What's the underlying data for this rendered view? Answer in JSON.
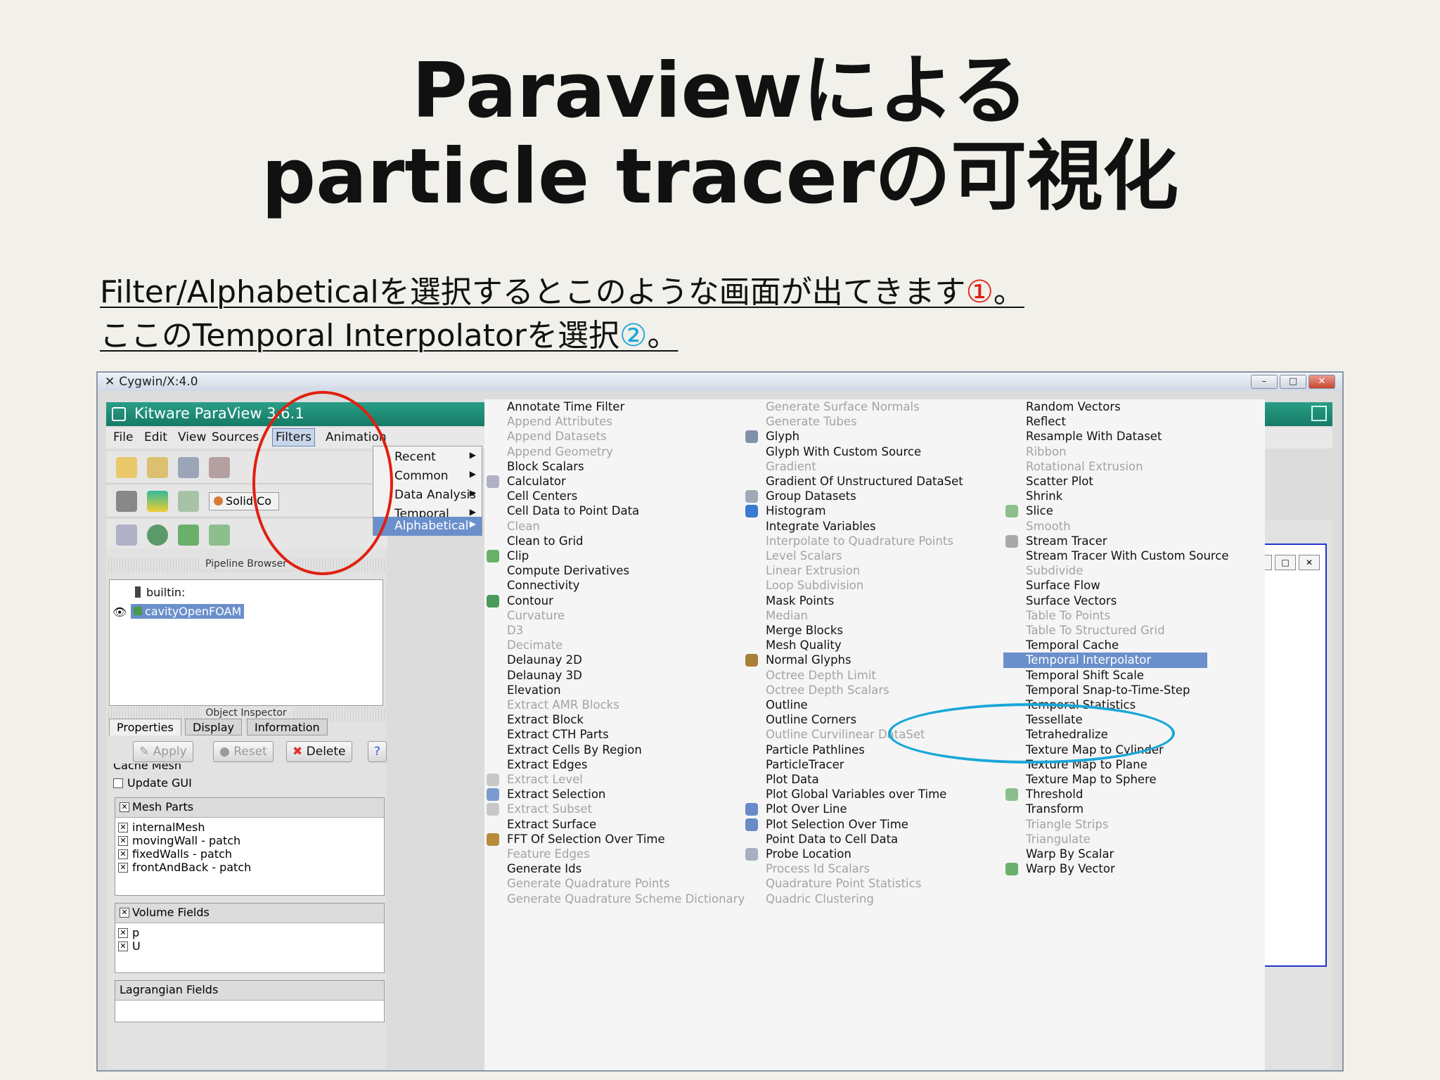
{
  "slide": {
    "title_line1": "Paraviewによる",
    "title_line2": "particle tracerの可視化",
    "desc_line1_text": "Filter/Alphabeticalを選択するとこのような画面が出てきます",
    "desc_line1_mark": "①",
    "desc_line1_end": "。",
    "desc_line2_text": "ここのTemporal Interpolatorを選択",
    "desc_line2_mark": "②",
    "desc_line2_end": "。"
  },
  "window": {
    "title": "Cygwin/X:4.0",
    "controls": [
      "–",
      "□",
      "✕"
    ],
    "app_title": "Kitware ParaView 3.6.1"
  },
  "menubar": {
    "items": [
      "File",
      "Edit",
      "View",
      "Sources",
      "Filters",
      "Animation"
    ],
    "active": "Filters"
  },
  "filters_menu": {
    "items": [
      "Recent",
      "Common",
      "Data Analysis",
      "Temporal",
      "Alphabetical"
    ],
    "selected": "Alphabetical"
  },
  "toolbar": {
    "representation_label": "Solid Co"
  },
  "pipeline": {
    "header": "Pipeline Browser",
    "root": "builtin:",
    "source": "cavityOpenFOAM"
  },
  "inspector": {
    "header": "Object Inspector",
    "tabs": [
      "Properties",
      "Display",
      "Information"
    ],
    "buttons": {
      "apply": "Apply",
      "reset": "Reset",
      "delete": "Delete",
      "help": "?"
    },
    "cache_mesh": "Cache Mesh",
    "update_gui": "Update GUI",
    "mesh_parts_title": "Mesh Parts",
    "mesh_parts": [
      "internalMesh",
      "movingWall - patch",
      "fixedWalls - patch",
      "frontAndBack - patch"
    ],
    "volume_fields_title": "Volume Fields",
    "volume_fields": [
      "p",
      "U"
    ],
    "lagrangian_title": "Lagrangian Fields"
  },
  "alphabetical": {
    "col1": [
      {
        "label": "Annotate Time Filter",
        "enabled": true
      },
      {
        "label": "Append Attributes",
        "enabled": false
      },
      {
        "label": "Append Datasets",
        "enabled": false
      },
      {
        "label": "Append Geometry",
        "enabled": false
      },
      {
        "label": "Block Scalars",
        "enabled": true
      },
      {
        "label": "Calculator",
        "enabled": true,
        "icon": "calculator-icon"
      },
      {
        "label": "Cell Centers",
        "enabled": true
      },
      {
        "label": "Cell Data to Point Data",
        "enabled": true
      },
      {
        "label": "Clean",
        "enabled": false
      },
      {
        "label": "Clean to Grid",
        "enabled": true
      },
      {
        "label": "Clip",
        "enabled": true,
        "icon": "clip-icon"
      },
      {
        "label": "Compute Derivatives",
        "enabled": true
      },
      {
        "label": "Connectivity",
        "enabled": true
      },
      {
        "label": "Contour",
        "enabled": true,
        "icon": "contour-icon"
      },
      {
        "label": "Curvature",
        "enabled": false
      },
      {
        "label": "D3",
        "enabled": false
      },
      {
        "label": "Decimate",
        "enabled": false
      },
      {
        "label": "Delaunay 2D",
        "enabled": true
      },
      {
        "label": "Delaunay 3D",
        "enabled": true
      },
      {
        "label": "Elevation",
        "enabled": true
      },
      {
        "label": "Extract AMR Blocks",
        "enabled": false
      },
      {
        "label": "Extract Block",
        "enabled": true
      },
      {
        "label": "Extract CTH Parts",
        "enabled": true
      },
      {
        "label": "Extract Cells By Region",
        "enabled": true
      },
      {
        "label": "Extract Edges",
        "enabled": true
      },
      {
        "label": "Extract Level",
        "enabled": false,
        "icon": "extract-level-icon"
      },
      {
        "label": "Extract Selection",
        "enabled": true,
        "icon": "extract-selection-icon"
      },
      {
        "label": "Extract Subset",
        "enabled": false,
        "icon": "extract-subset-icon"
      },
      {
        "label": "Extract Surface",
        "enabled": true
      },
      {
        "label": "FFT Of Selection Over Time",
        "enabled": true,
        "icon": "fft-icon"
      },
      {
        "label": "Feature Edges",
        "enabled": false
      },
      {
        "label": "Generate Ids",
        "enabled": true
      },
      {
        "label": "Generate Quadrature Points",
        "enabled": false
      },
      {
        "label": "Generate Quadrature Scheme Dictionary",
        "enabled": false
      }
    ],
    "col2": [
      {
        "label": "Generate Surface Normals",
        "enabled": false
      },
      {
        "label": "Generate Tubes",
        "enabled": false
      },
      {
        "label": "Glyph",
        "enabled": true,
        "icon": "glyph-icon"
      },
      {
        "label": "Glyph With Custom Source",
        "enabled": true
      },
      {
        "label": "Gradient",
        "enabled": false
      },
      {
        "label": "Gradient Of Unstructured DataSet",
        "enabled": true
      },
      {
        "label": "Group Datasets",
        "enabled": true,
        "icon": "group-icon"
      },
      {
        "label": "Histogram",
        "enabled": true,
        "icon": "histogram-icon"
      },
      {
        "label": "Integrate Variables",
        "enabled": true
      },
      {
        "label": "Interpolate to Quadrature Points",
        "enabled": false
      },
      {
        "label": "Level Scalars",
        "enabled": false
      },
      {
        "label": "Linear Extrusion",
        "enabled": false
      },
      {
        "label": "Loop Subdivision",
        "enabled": false
      },
      {
        "label": "Mask Points",
        "enabled": true
      },
      {
        "label": "Median",
        "enabled": false
      },
      {
        "label": "Merge Blocks",
        "enabled": true
      },
      {
        "label": "Mesh Quality",
        "enabled": true
      },
      {
        "label": "Normal Glyphs",
        "enabled": true,
        "icon": "normal-glyphs-icon"
      },
      {
        "label": "Octree Depth Limit",
        "enabled": false
      },
      {
        "label": "Octree Depth Scalars",
        "enabled": false
      },
      {
        "label": "Outline",
        "enabled": true
      },
      {
        "label": "Outline Corners",
        "enabled": true
      },
      {
        "label": "Outline Curvilinear DataSet",
        "enabled": false
      },
      {
        "label": "Particle Pathlines",
        "enabled": true
      },
      {
        "label": "ParticleTracer",
        "enabled": true
      },
      {
        "label": "Plot Data",
        "enabled": true
      },
      {
        "label": "Plot Global Variables over Time",
        "enabled": true
      },
      {
        "label": "Plot Over Line",
        "enabled": true,
        "icon": "plot-over-line-icon"
      },
      {
        "label": "Plot Selection Over Time",
        "enabled": true,
        "icon": "plot-selection-icon"
      },
      {
        "label": "Point Data to Cell Data",
        "enabled": true
      },
      {
        "label": "Probe Location",
        "enabled": true,
        "icon": "probe-icon"
      },
      {
        "label": "Process Id Scalars",
        "enabled": false
      },
      {
        "label": "Quadrature Point Statistics",
        "enabled": false
      },
      {
        "label": "Quadric Clustering",
        "enabled": false
      }
    ],
    "col3": [
      {
        "label": "Random Vectors",
        "enabled": true
      },
      {
        "label": "Reflect",
        "enabled": true
      },
      {
        "label": "Resample With Dataset",
        "enabled": true
      },
      {
        "label": "Ribbon",
        "enabled": false
      },
      {
        "label": "Rotational Extrusion",
        "enabled": false
      },
      {
        "label": "Scatter Plot",
        "enabled": true
      },
      {
        "label": "Shrink",
        "enabled": true
      },
      {
        "label": "Slice",
        "enabled": true,
        "icon": "slice-icon"
      },
      {
        "label": "Smooth",
        "enabled": false
      },
      {
        "label": "Stream Tracer",
        "enabled": true,
        "icon": "stream-tracer-icon"
      },
      {
        "label": "Stream Tracer With Custom Source",
        "enabled": true
      },
      {
        "label": "Subdivide",
        "enabled": false
      },
      {
        "label": "Surface Flow",
        "enabled": true
      },
      {
        "label": "Surface Vectors",
        "enabled": true
      },
      {
        "label": "Table To Points",
        "enabled": false
      },
      {
        "label": "Table To Structured Grid",
        "enabled": false
      },
      {
        "label": "Temporal Cache",
        "enabled": true
      },
      {
        "label": "Temporal Interpolator",
        "enabled": true,
        "selected": true
      },
      {
        "label": "Temporal Shift Scale",
        "enabled": true
      },
      {
        "label": "Temporal Snap-to-Time-Step",
        "enabled": true
      },
      {
        "label": "Temporal Statistics",
        "enabled": true
      },
      {
        "label": "Tessellate",
        "enabled": true
      },
      {
        "label": "Tetrahedralize",
        "enabled": true
      },
      {
        "label": "Texture Map to Cylinder",
        "enabled": true
      },
      {
        "label": "Texture Map to Plane",
        "enabled": true
      },
      {
        "label": "Texture Map to Sphere",
        "enabled": true
      },
      {
        "label": "Threshold",
        "enabled": true,
        "icon": "threshold-icon"
      },
      {
        "label": "Transform",
        "enabled": true
      },
      {
        "label": "Triangle Strips",
        "enabled": false
      },
      {
        "label": "Triangulate",
        "enabled": false
      },
      {
        "label": "Warp By Scalar",
        "enabled": true
      },
      {
        "label": "Warp By Vector",
        "enabled": true,
        "icon": "warp-vector-icon"
      }
    ]
  },
  "colors": {
    "accent_red": "#e02010",
    "accent_blue": "#1aa7d8",
    "menu_selection": "#6a8fcb",
    "titlebar": "#157a66"
  }
}
